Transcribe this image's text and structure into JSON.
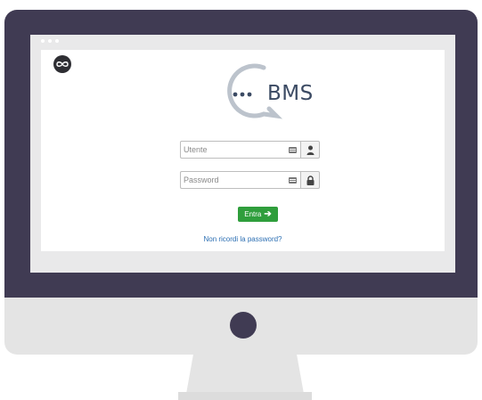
{
  "brand": {
    "logo_text": "BMS"
  },
  "login_form": {
    "username": {
      "placeholder": "Utente",
      "value": ""
    },
    "password": {
      "placeholder": "Password",
      "value": ""
    },
    "submit_label": "Entra",
    "forgot_password_link": "Non ricordi la password?"
  },
  "colors": {
    "bezel": "#403b53",
    "submit_button": "#2f9e3c",
    "link": "#2c6fb3"
  },
  "icons": [
    "infinity-logo-icon",
    "keyboard-icon",
    "user-icon",
    "lock-icon",
    "arrow-right-icon"
  ]
}
